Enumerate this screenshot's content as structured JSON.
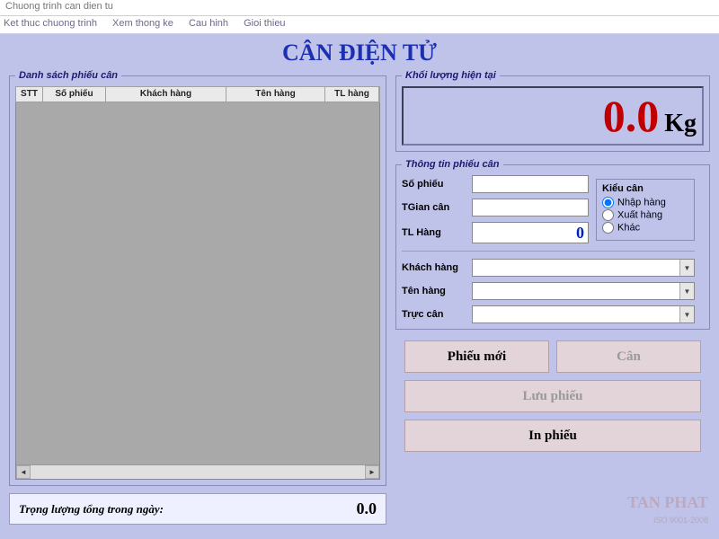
{
  "window": {
    "title": "Chuong trinh can dien tu"
  },
  "menu": {
    "items": [
      "Ket thuc chuong trinh",
      "Xem thong ke",
      "Cau hinh",
      "Gioi thieu"
    ]
  },
  "app_title": "CÂN  ĐIỆN  TỬ",
  "left": {
    "legend": "Danh sách phiếu cân",
    "headers": {
      "stt": "STT",
      "so_phieu": "Số phiếu",
      "khach_hang": "Khách hàng",
      "ten_hang": "Tên hàng",
      "tl_hang": "TL hàng"
    },
    "daily_total_label": "Trọng lượng tổng trong ngày:",
    "daily_total_value": "0.0"
  },
  "weight": {
    "legend": "Khối lượng hiện tại",
    "value": "0.0",
    "unit": "Kg"
  },
  "info": {
    "legend": "Thông tin phiếu cân",
    "so_phieu_label": "Số phiếu",
    "so_phieu_value": "",
    "tgian_label": "TGian cân",
    "tgian_value": "",
    "tl_label": "TL Hàng",
    "tl_value": "0",
    "kieu_can": {
      "title": "Kiểu cân",
      "nhap": "Nhập hàng",
      "xuat": "Xuất hàng",
      "khac": "Khác"
    },
    "khach_hang_label": "Khách hàng",
    "ten_hang_label": "Tên hàng",
    "truc_can_label": "Trực cân"
  },
  "buttons": {
    "phieu_moi": "Phiếu mới",
    "can": "Cân",
    "luu_phieu": "Lưu phiếu",
    "in_phieu": "In phiếu"
  },
  "watermark": {
    "main": "TAN PHAT",
    "sub": "ISO 9001-2008"
  }
}
